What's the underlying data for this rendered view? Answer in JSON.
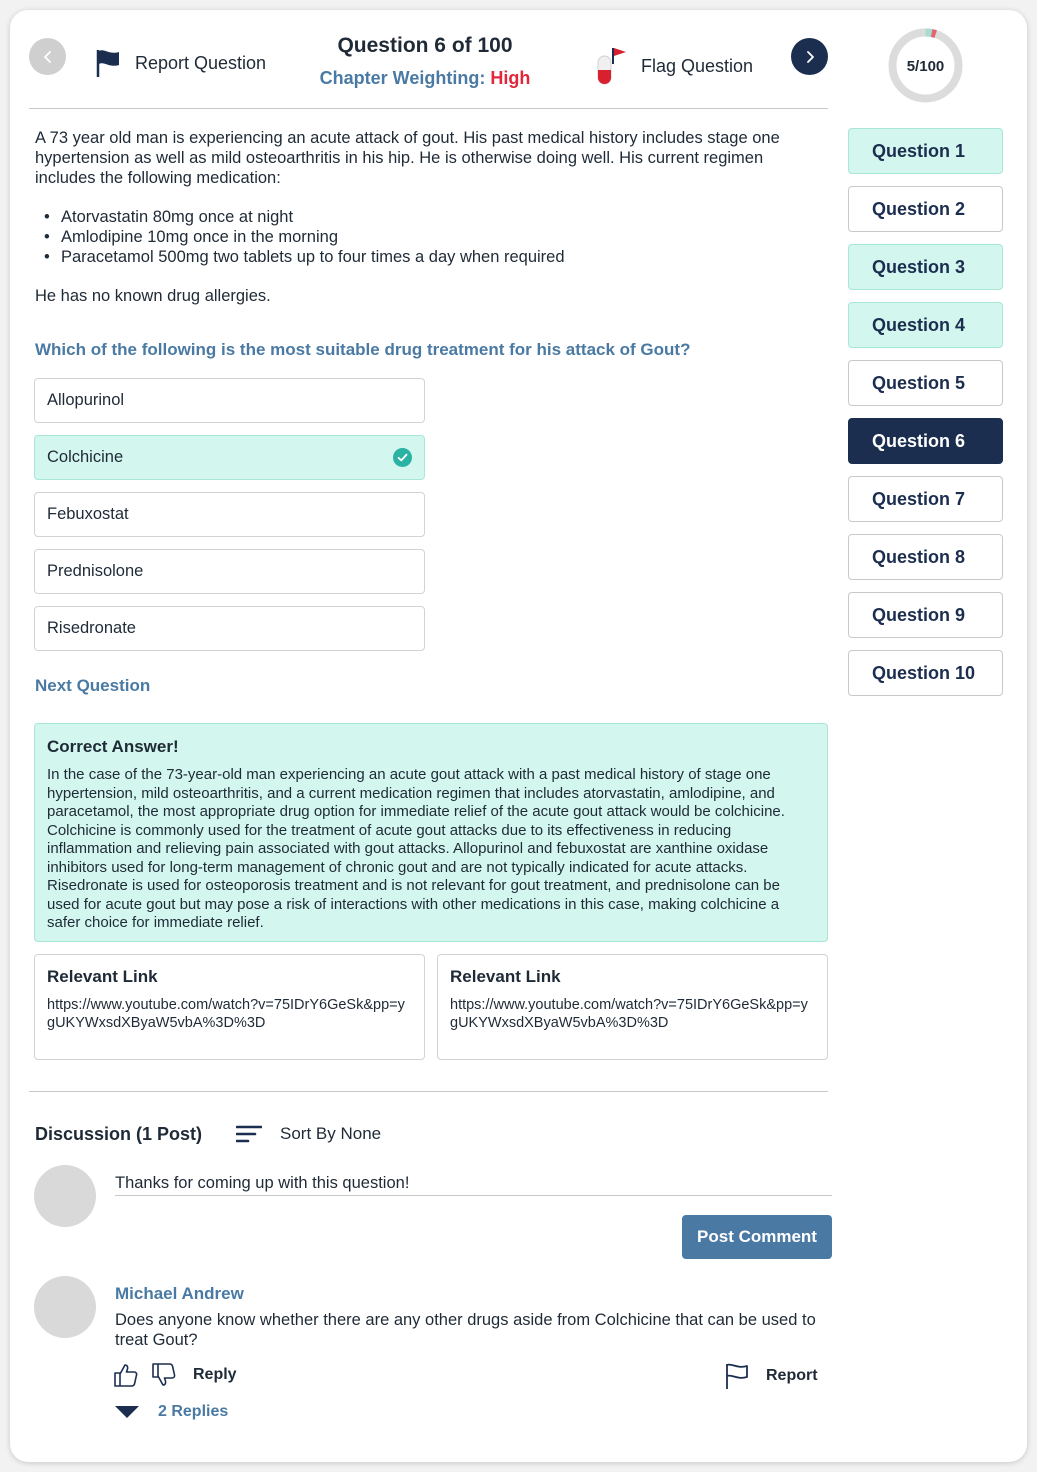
{
  "header": {
    "report_label": "Report Question",
    "title": "Question 6 of 100",
    "weighting_label": "Chapter Weighting:",
    "weighting_value": "High",
    "flag_label": "Flag Question"
  },
  "progress": {
    "label": "5/100",
    "answered": 5,
    "total": 100,
    "correct": 3,
    "incorrect": 2,
    "colors": {
      "correct": "#a8dcd0",
      "incorrect": "#e3646c",
      "track": "#dcdcdc"
    }
  },
  "question_list": [
    {
      "label": "Question 1",
      "status": "correct"
    },
    {
      "label": "Question 2",
      "status": "incorrect"
    },
    {
      "label": "Question 3",
      "status": "correct"
    },
    {
      "label": "Question 4",
      "status": "correct"
    },
    {
      "label": "Question 5",
      "status": "incorrect"
    },
    {
      "label": "Question 6",
      "status": "current"
    },
    {
      "label": "Question 7",
      "status": "unanswered"
    },
    {
      "label": "Question 8",
      "status": "unanswered"
    },
    {
      "label": "Question 9",
      "status": "unanswered"
    },
    {
      "label": "Question 10",
      "status": "unanswered"
    }
  ],
  "stem": {
    "intro": "A 73 year old man is experiencing an acute attack of gout. His past medical history includes stage one hypertension as well as mild osteoarthritis in his hip. He is otherwise doing well.  His current regimen includes the following medication:",
    "medications": [
      "Atorvastatin 80mg once at night",
      "Amlodipine 10mg once in the morning",
      "Paracetamol 500mg two tablets up to four times a day when required"
    ],
    "allergies": "He has no known drug allergies.",
    "prompt": "Which of the following is the most suitable drug treatment for his attack of Gout?"
  },
  "options": [
    {
      "label": "Allopurinol",
      "selected": false
    },
    {
      "label": "Colchicine",
      "selected": true
    },
    {
      "label": "Febuxostat",
      "selected": false
    },
    {
      "label": "Prednisolone",
      "selected": false
    },
    {
      "label": "Risedronate",
      "selected": false
    }
  ],
  "next_question_label": "Next Question",
  "answer": {
    "title": "Correct Answer!",
    "text": "In the case of the 73-year-old man experiencing an acute gout attack with a past medical history of stage one hypertension, mild osteoarthritis, and a current medication regimen that includes atorvastatin, amlodipine, and paracetamol, the most appropriate drug option for immediate relief of the acute gout attack would be colchicine. Colchicine is commonly used for the treatment of acute gout attacks due to its effectiveness in reducing inflammation and relieving pain associated with gout attacks. Allopurinol and febuxostat are xanthine oxidase inhibitors used for long-term management of chronic gout and are not typically indicated for acute attacks. Risedronate is used for osteoporosis treatment and is not relevant for gout treatment, and prednisolone can be used for acute gout but may pose a risk of interactions with other medications in this case, making colchicine a safer choice for immediate relief."
  },
  "links": [
    {
      "title": "Relevant Link",
      "url": "https://www.youtube.com/watch?v=75IDrY6GeSk&pp=ygUKYWxsdXByaW5vbA%3D%3D"
    },
    {
      "title": "Relevant Link",
      "url": "https://www.youtube.com/watch?v=75IDrY6GeSk&pp=ygUKYWxsdXByaW5vbA%3D%3D"
    }
  ],
  "discussion": {
    "title": "Discussion (1 Post)",
    "sort_label": "Sort By None",
    "comment_value": "Thanks for coming up with this question!",
    "post_button": "Post Comment",
    "posts": [
      {
        "author": "Michael Andrew",
        "text": "Does anyone know whether there are any other drugs aside from Colchicine that can be used to treat Gout?",
        "reply_label": "Reply",
        "report_label": "Report",
        "replies_label": "2 Replies"
      }
    ]
  },
  "icons": {
    "prev": "chevron-left-icon",
    "next": "chevron-right-icon",
    "report": "flag-icon",
    "flag": "pill-flag-icon",
    "check": "check-circle-icon",
    "sort": "sort-lines-icon",
    "like": "thumbs-up-icon",
    "dislike": "thumbs-down-icon",
    "expand": "caret-down-icon"
  },
  "colors": {
    "navy": "#1c2e4f",
    "accent_blue": "#4a7aa3",
    "high_red": "#e3263a",
    "correct_bg": "#d3f6ee",
    "incorrect_bg": "#f1b8bb",
    "check_teal": "#2ab3a3"
  }
}
